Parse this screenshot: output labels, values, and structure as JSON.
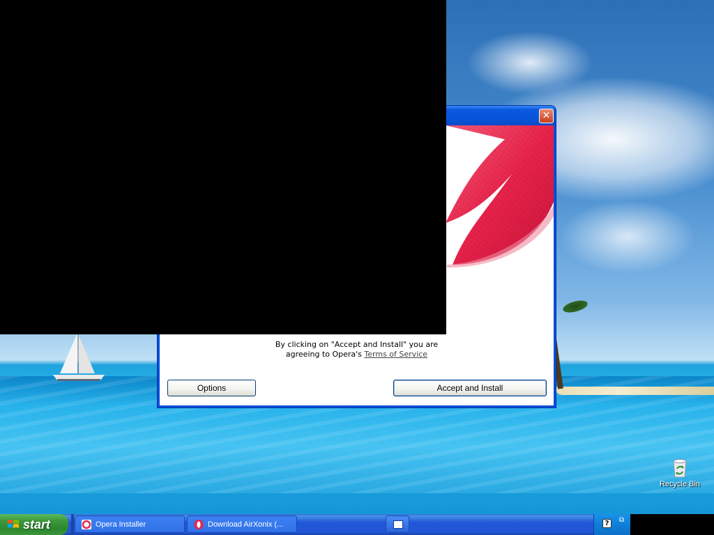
{
  "desktop": {
    "icons": [
      {
        "label": "Recycle Bin",
        "icon": "recycle-bin-icon"
      }
    ]
  },
  "installer": {
    "window_title": "",
    "close_button": "✕",
    "agreement_text_line1": "By clicking on \"Accept and Install\" you are",
    "agreement_text_line2_prefix": "agreeing to Opera's",
    "terms_link": "Terms of Service",
    "options_button": "Options",
    "accept_button": "Accept and Install",
    "banner_color": "#e8234a"
  },
  "taskbar": {
    "start_label": "start",
    "tasks": [
      {
        "label": "Opera Installer",
        "icon": "opera-installer-icon"
      },
      {
        "label": "Download AirXonix (...",
        "icon": "opera-browser-icon"
      }
    ],
    "tray": {
      "help_icon": "?",
      "restore_icon": "⧉"
    }
  },
  "colors": {
    "xp_blue": "#0a4fd8",
    "start_green": "#3c9a3c",
    "opera_red": "#e8234a"
  }
}
